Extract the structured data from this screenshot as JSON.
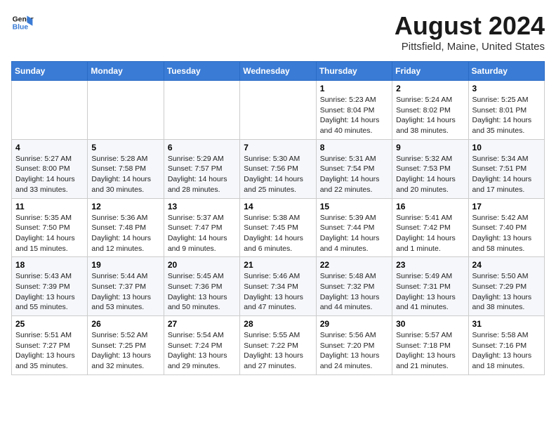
{
  "header": {
    "logo_line1": "General",
    "logo_line2": "Blue",
    "month_year": "August 2024",
    "location": "Pittsfield, Maine, United States"
  },
  "weekdays": [
    "Sunday",
    "Monday",
    "Tuesday",
    "Wednesday",
    "Thursday",
    "Friday",
    "Saturday"
  ],
  "weeks": [
    [
      {
        "day": "",
        "info": ""
      },
      {
        "day": "",
        "info": ""
      },
      {
        "day": "",
        "info": ""
      },
      {
        "day": "",
        "info": ""
      },
      {
        "day": "1",
        "info": "Sunrise: 5:23 AM\nSunset: 8:04 PM\nDaylight: 14 hours\nand 40 minutes."
      },
      {
        "day": "2",
        "info": "Sunrise: 5:24 AM\nSunset: 8:02 PM\nDaylight: 14 hours\nand 38 minutes."
      },
      {
        "day": "3",
        "info": "Sunrise: 5:25 AM\nSunset: 8:01 PM\nDaylight: 14 hours\nand 35 minutes."
      }
    ],
    [
      {
        "day": "4",
        "info": "Sunrise: 5:27 AM\nSunset: 8:00 PM\nDaylight: 14 hours\nand 33 minutes."
      },
      {
        "day": "5",
        "info": "Sunrise: 5:28 AM\nSunset: 7:58 PM\nDaylight: 14 hours\nand 30 minutes."
      },
      {
        "day": "6",
        "info": "Sunrise: 5:29 AM\nSunset: 7:57 PM\nDaylight: 14 hours\nand 28 minutes."
      },
      {
        "day": "7",
        "info": "Sunrise: 5:30 AM\nSunset: 7:56 PM\nDaylight: 14 hours\nand 25 minutes."
      },
      {
        "day": "8",
        "info": "Sunrise: 5:31 AM\nSunset: 7:54 PM\nDaylight: 14 hours\nand 22 minutes."
      },
      {
        "day": "9",
        "info": "Sunrise: 5:32 AM\nSunset: 7:53 PM\nDaylight: 14 hours\nand 20 minutes."
      },
      {
        "day": "10",
        "info": "Sunrise: 5:34 AM\nSunset: 7:51 PM\nDaylight: 14 hours\nand 17 minutes."
      }
    ],
    [
      {
        "day": "11",
        "info": "Sunrise: 5:35 AM\nSunset: 7:50 PM\nDaylight: 14 hours\nand 15 minutes."
      },
      {
        "day": "12",
        "info": "Sunrise: 5:36 AM\nSunset: 7:48 PM\nDaylight: 14 hours\nand 12 minutes."
      },
      {
        "day": "13",
        "info": "Sunrise: 5:37 AM\nSunset: 7:47 PM\nDaylight: 14 hours\nand 9 minutes."
      },
      {
        "day": "14",
        "info": "Sunrise: 5:38 AM\nSunset: 7:45 PM\nDaylight: 14 hours\nand 6 minutes."
      },
      {
        "day": "15",
        "info": "Sunrise: 5:39 AM\nSunset: 7:44 PM\nDaylight: 14 hours\nand 4 minutes."
      },
      {
        "day": "16",
        "info": "Sunrise: 5:41 AM\nSunset: 7:42 PM\nDaylight: 14 hours\nand 1 minute."
      },
      {
        "day": "17",
        "info": "Sunrise: 5:42 AM\nSunset: 7:40 PM\nDaylight: 13 hours\nand 58 minutes."
      }
    ],
    [
      {
        "day": "18",
        "info": "Sunrise: 5:43 AM\nSunset: 7:39 PM\nDaylight: 13 hours\nand 55 minutes."
      },
      {
        "day": "19",
        "info": "Sunrise: 5:44 AM\nSunset: 7:37 PM\nDaylight: 13 hours\nand 53 minutes."
      },
      {
        "day": "20",
        "info": "Sunrise: 5:45 AM\nSunset: 7:36 PM\nDaylight: 13 hours\nand 50 minutes."
      },
      {
        "day": "21",
        "info": "Sunrise: 5:46 AM\nSunset: 7:34 PM\nDaylight: 13 hours\nand 47 minutes."
      },
      {
        "day": "22",
        "info": "Sunrise: 5:48 AM\nSunset: 7:32 PM\nDaylight: 13 hours\nand 44 minutes."
      },
      {
        "day": "23",
        "info": "Sunrise: 5:49 AM\nSunset: 7:31 PM\nDaylight: 13 hours\nand 41 minutes."
      },
      {
        "day": "24",
        "info": "Sunrise: 5:50 AM\nSunset: 7:29 PM\nDaylight: 13 hours\nand 38 minutes."
      }
    ],
    [
      {
        "day": "25",
        "info": "Sunrise: 5:51 AM\nSunset: 7:27 PM\nDaylight: 13 hours\nand 35 minutes."
      },
      {
        "day": "26",
        "info": "Sunrise: 5:52 AM\nSunset: 7:25 PM\nDaylight: 13 hours\nand 32 minutes."
      },
      {
        "day": "27",
        "info": "Sunrise: 5:54 AM\nSunset: 7:24 PM\nDaylight: 13 hours\nand 29 minutes."
      },
      {
        "day": "28",
        "info": "Sunrise: 5:55 AM\nSunset: 7:22 PM\nDaylight: 13 hours\nand 27 minutes."
      },
      {
        "day": "29",
        "info": "Sunrise: 5:56 AM\nSunset: 7:20 PM\nDaylight: 13 hours\nand 24 minutes."
      },
      {
        "day": "30",
        "info": "Sunrise: 5:57 AM\nSunset: 7:18 PM\nDaylight: 13 hours\nand 21 minutes."
      },
      {
        "day": "31",
        "info": "Sunrise: 5:58 AM\nSunset: 7:16 PM\nDaylight: 13 hours\nand 18 minutes."
      }
    ]
  ]
}
